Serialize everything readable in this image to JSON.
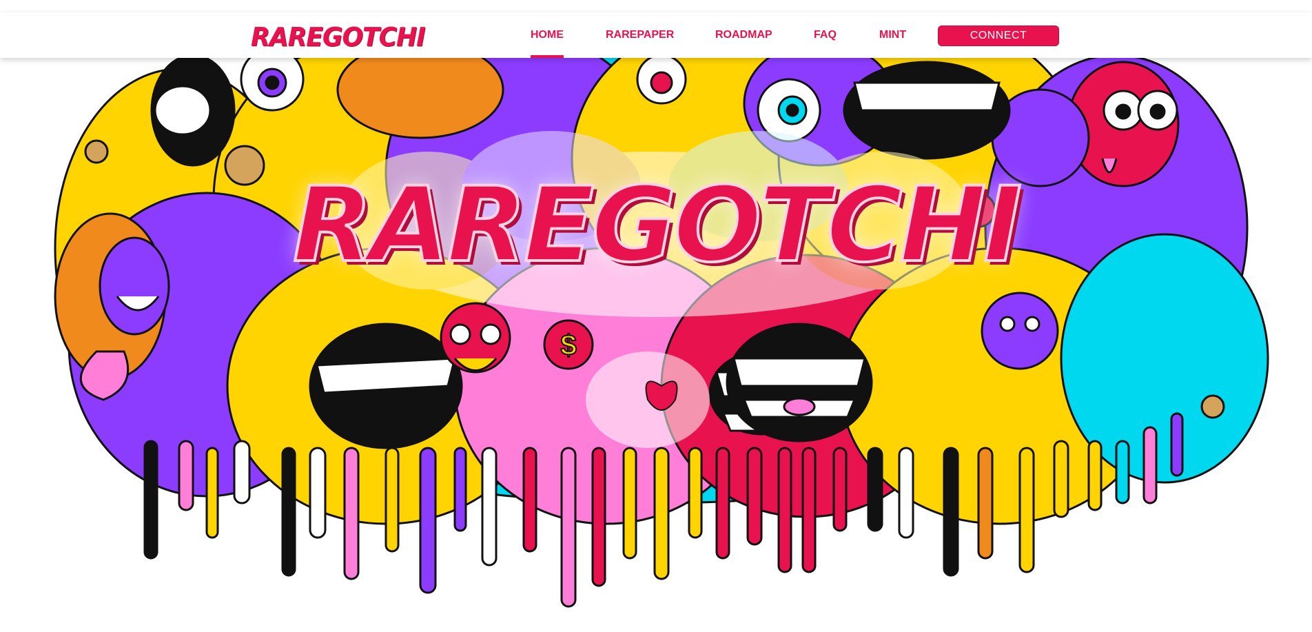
{
  "brand": {
    "logo_text": "RAREGOTCHI"
  },
  "nav": {
    "items": [
      {
        "label": "HOME",
        "active": true
      },
      {
        "label": "RAREPAPER",
        "active": false
      },
      {
        "label": "ROADMAP",
        "active": false
      },
      {
        "label": "FAQ",
        "active": false
      },
      {
        "label": "MINT",
        "active": false
      }
    ],
    "connect_label": "CONNECT"
  },
  "hero": {
    "title": "RAREGOTCHI"
  },
  "colors": {
    "accent": "#e8124f",
    "yellow": "#ffd400",
    "cyan": "#00d8f0",
    "purple": "#8b3cff",
    "pink": "#ff7fd8",
    "orange": "#f08a1c",
    "black": "#111111",
    "white": "#ffffff"
  }
}
